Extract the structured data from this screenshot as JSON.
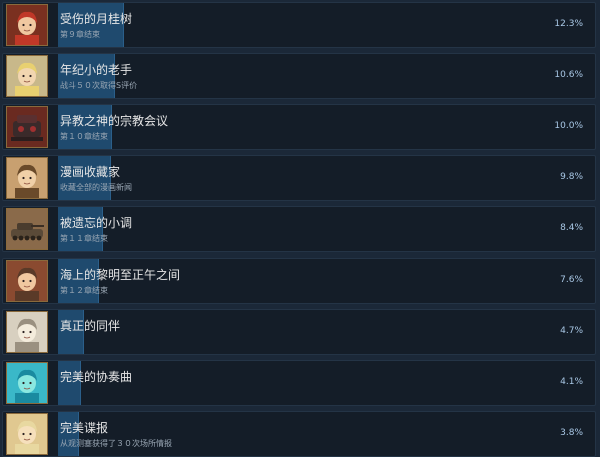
{
  "achievements": [
    {
      "title": "受伤的月桂树",
      "desc": "第９章结束",
      "pct": "12.3%",
      "value": 12.3,
      "icon": "red-haired-girl-portrait-icon",
      "bg": "#7a3020",
      "face": "#f0c8a0",
      "hair": "#c03828"
    },
    {
      "title": "年纪小的老手",
      "desc": "战斗５０次取得S评价",
      "pct": "10.6%",
      "value": 10.6,
      "icon": "blonde-soldier-portrait-icon",
      "bg": "#c8b88a",
      "face": "#f2d6b0",
      "hair": "#e8d070"
    },
    {
      "title": "异教之神的宗教会议",
      "desc": "第１０章结束",
      "pct": "10.0%",
      "value": 10.0,
      "icon": "dark-machine-icon",
      "bg": "#6a2a20",
      "face": "#3a2a2a",
      "hair": "#a03030"
    },
    {
      "title": "漫画收藏家",
      "desc": "收藏全部的漫画新闻",
      "pct": "9.8%",
      "value": 9.8,
      "icon": "man-portrait-icon",
      "bg": "#c8a070",
      "face": "#f0d0a8",
      "hair": "#6a4a2a"
    },
    {
      "title": "被遗忘的小调",
      "desc": "第１１章结束",
      "pct": "8.4%",
      "value": 8.4,
      "icon": "tank-icon",
      "bg": "#8a6a4a",
      "face": "#4a3a2a",
      "hair": "#3a3028"
    },
    {
      "title": "海上的黎明至正午之间",
      "desc": "第１２章结束",
      "pct": "7.6%",
      "value": 7.6,
      "icon": "officer-portrait-icon",
      "bg": "#8a4a30",
      "face": "#f0c8a0",
      "hair": "#5a3a28"
    },
    {
      "title": "真正的同伴",
      "desc": "",
      "pct": "4.7%",
      "value": 4.7,
      "icon": "sketch-portrait-icon",
      "bg": "#d8d0c0",
      "face": "#f4ecdc",
      "hair": "#9a9080"
    },
    {
      "title": "完美的协奏曲",
      "desc": "",
      "pct": "4.1%",
      "value": 4.1,
      "icon": "cyan-character-portrait-icon",
      "bg": "#3ab8c8",
      "face": "#8ae8e0",
      "hair": "#1a8aa0"
    },
    {
      "title": "完美谍报",
      "desc": "从观测塞获得了３０次场所情报",
      "pct": "3.8%",
      "value": 3.8,
      "icon": "cat-eared-girl-portrait-icon",
      "bg": "#e0c890",
      "face": "#f6e0bc",
      "hair": "#e8d8a0"
    }
  ]
}
